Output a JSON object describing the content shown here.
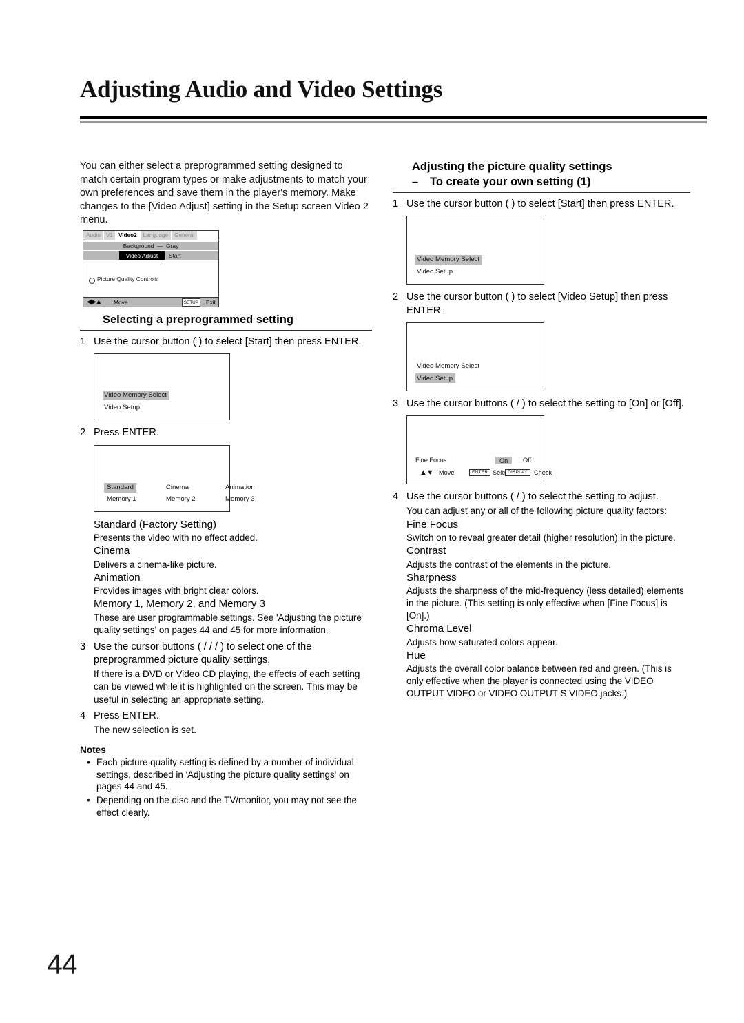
{
  "document": {
    "title": "Adjusting Audio and Video Settings",
    "page_number": "44"
  },
  "left_column": {
    "intro": "You can either select a preprogrammed setting designed to match certain program types or make adjustments to match your own preferences and save them in the player's memory. Make changes to the [Video Adjust] setting in the Setup screen Video 2 menu.",
    "setup_screen": {
      "tabs": [
        "Audio",
        "V1",
        "Video2",
        "Language",
        "General"
      ],
      "active_tab": "Video2",
      "background_label": "Background",
      "background_value": "Gray",
      "video_adjust_label": "Video Adjust",
      "video_adjust_value": "Start",
      "info_text": "Picture Quality Controls",
      "info_icon": "i",
      "footer_move": "Move",
      "footer_key": "SETUP",
      "footer_exit": "Exit"
    },
    "section_heading": "Selecting a preprogrammed setting",
    "steps": [
      {
        "num": "1",
        "text": "Use the cursor button (   ) to select [Start] then press ENTER."
      },
      {
        "num": "2",
        "text": "Press ENTER."
      },
      {
        "num": "3",
        "text": "Use the cursor buttons (   /   /   /   ) to select one of the preprogrammed picture quality settings.",
        "sub": "If there is a DVD or Video CD playing, the effects of each setting can be viewed while it is highlighted on the screen. This may be useful in selecting an appropriate setting."
      },
      {
        "num": "4",
        "text": "Press ENTER.",
        "sub": "The new selection is set."
      }
    ],
    "osd_memory_select": {
      "line1": "Video Memory Select",
      "line2": "Video Setup",
      "highlighted": "Video Memory Select"
    },
    "osd_preset_grid": {
      "row1": [
        "Standard",
        "Cinema",
        "Animation"
      ],
      "row2": [
        "Memory 1",
        "Memory 2",
        "Memory 3"
      ],
      "highlighted": "Standard"
    },
    "presets": [
      {
        "name": "Standard (Factory Setting)",
        "desc": "Presents the video with no effect added."
      },
      {
        "name": "Cinema",
        "desc": "Delivers a cinema-like picture."
      },
      {
        "name": "Animation",
        "desc": "Provides images with bright clear colors."
      },
      {
        "name": "Memory 1, Memory 2, and Memory 3",
        "desc": "These are user programmable settings. See 'Adjusting the picture quality settings' on pages 44 and 45 for more information."
      }
    ],
    "notes_title": "Notes",
    "notes": [
      "Each picture quality setting is defined by a number of individual settings,  described in 'Adjusting the picture quality settings' on pages 44 and 45.",
      "Depending on the disc and the TV/monitor, you may not see the effect clearly."
    ]
  },
  "right_column": {
    "heading": "Adjusting the picture quality settings",
    "subheading": "To create your own setting (1)",
    "dash": "–",
    "steps": [
      {
        "num": "1",
        "text": "Use the cursor button (   ) to select [Start] then press ENTER."
      },
      {
        "num": "2",
        "text": "Use the cursor button (   ) to select [Video Setup] then press ENTER."
      },
      {
        "num": "3",
        "text": "Use the cursor buttons (   /   ) to select the setting to [On] or [Off]."
      },
      {
        "num": "4",
        "text": "Use the cursor buttons (   /   ) to select the setting to adjust.",
        "sub": "You can adjust any or all of the following picture quality factors:"
      }
    ],
    "osd_memory_select_1": {
      "line1": "Video Memory Select",
      "line2": "Video Setup",
      "highlighted": "Video Memory Select"
    },
    "osd_memory_select_2": {
      "line1": "Video Memory Select",
      "line2": "Video Setup",
      "highlighted": "Video Setup"
    },
    "osd_fine_focus": {
      "label": "Fine Focus",
      "option_on": "On",
      "option_off": "Off",
      "selected": "On",
      "move_label": "Move",
      "enter_key": "ENTER",
      "select_label": "Select",
      "display_key": "DISPLAY",
      "check_label": "Check"
    },
    "factors": [
      {
        "name": "Fine Focus",
        "desc": "Switch on to reveal greater detail (higher resolution) in the picture."
      },
      {
        "name": "Contrast",
        "desc": "Adjusts the contrast of the elements in the picture."
      },
      {
        "name": "Sharpness",
        "desc": "Adjusts the sharpness of the mid-frequency (less detailed) elements in the picture. (This setting is only effective when [Fine Focus] is [On].)"
      },
      {
        "name": "Chroma Level",
        "desc": "Adjusts how saturated colors appear."
      },
      {
        "name": "Hue",
        "desc": "Adjusts the overall color balance between red and green. (This is only effective when the player is connected using the VIDEO OUTPUT VIDEO or VIDEO OUTPUT S VIDEO jacks.)"
      }
    ]
  },
  "colors": {
    "highlight_grey": "#bdbdbd",
    "menu_bar_grey": "#b8b8b8",
    "rule_dark": "#000000",
    "rule_grey": "#9a9a9a"
  }
}
